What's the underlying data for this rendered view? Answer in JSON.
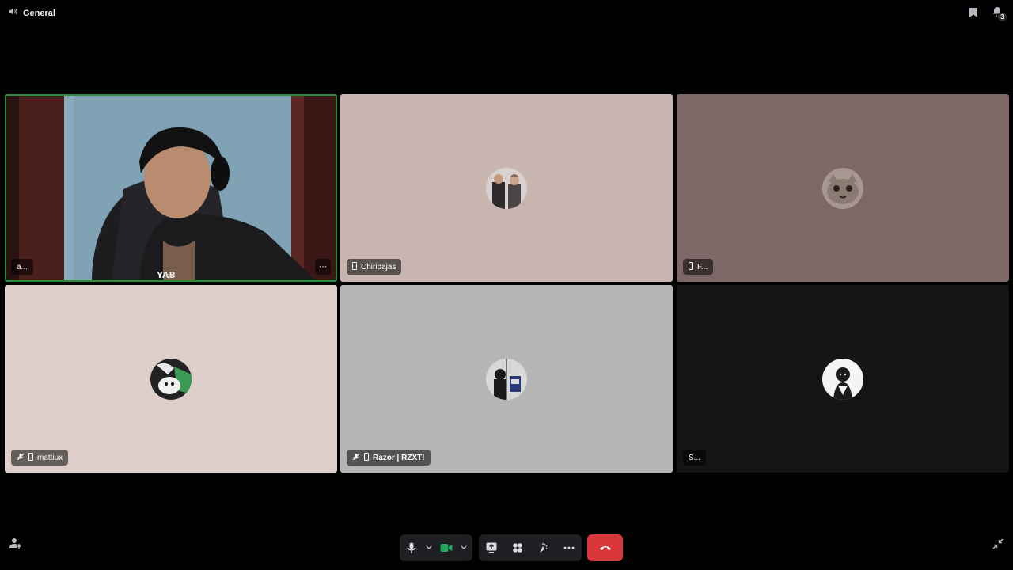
{
  "channel": {
    "icon": "speaker-icon",
    "name": "General"
  },
  "top_actions": {
    "pinned_icon": "bookmark-icon",
    "activity_icon": "activity-icon",
    "activity_count": "3"
  },
  "tiles": [
    {
      "label": "a...",
      "color": "#7fa2b4",
      "type": "video",
      "speaking": true
    },
    {
      "label": "Chiripajas",
      "color": "#c8b5b0",
      "device": "mobile-icon"
    },
    {
      "label": "F...",
      "color": "#7d6867",
      "device": "mobile-icon"
    },
    {
      "label": "mattiux",
      "color": "#dfcfcb",
      "device": "mobile-icon",
      "muted": true
    },
    {
      "label": "Razor | RZXT!",
      "color": "#b5b5b5",
      "device": "mobile-icon",
      "muted": true
    },
    {
      "label": "S...",
      "color": "#141414"
    }
  ],
  "controls": {
    "mic_icon": "microphone-icon",
    "camera_icon": "camera-icon",
    "screenshare_icon": "screenshare-icon",
    "activities_icon": "activities-icon",
    "soundboard_icon": "soundboard-icon",
    "more_icon": "more-icon",
    "leave_icon": "hangup-icon",
    "accent_leave": "#da373c",
    "accent_camera": "#23a55a"
  }
}
